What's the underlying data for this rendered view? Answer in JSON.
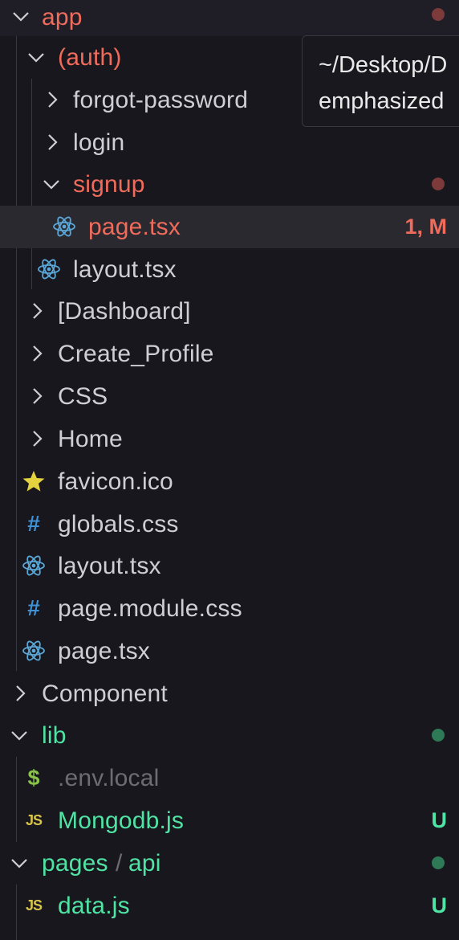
{
  "colors": {
    "background": "#18171d",
    "modified_red": "#ef6b5b",
    "untracked_green": "#4fe3a4",
    "default_text": "#cfcfd3",
    "ignored_text": "#6d6c73",
    "react_blue": "#5ba7d8",
    "css_blue": "#3f92d6",
    "js_yellow": "#d7c44b",
    "env_green": "#8bc34a",
    "favicon_yellow": "#e4d23f",
    "dot_red": "#7c3a3a",
    "dot_green": "#2f7a56"
  },
  "tooltip": {
    "line1": "~/Desktop/D",
    "line2": "emphasized"
  },
  "tree": {
    "app": {
      "label": "app",
      "icon": "chevron-down-icon"
    },
    "auth": {
      "label": "(auth)",
      "icon": "chevron-down-icon"
    },
    "forgot_password": {
      "label": "forgot-password",
      "icon": "chevron-right-icon"
    },
    "login": {
      "label": "login",
      "icon": "chevron-right-icon"
    },
    "signup": {
      "label": "signup",
      "icon": "chevron-down-icon"
    },
    "signup_page": {
      "label": "page.tsx",
      "badge": "1, M",
      "icon": "react-icon"
    },
    "auth_layout": {
      "label": "layout.tsx",
      "icon": "react-icon"
    },
    "dashboard": {
      "label": "[Dashboard]",
      "icon": "chevron-right-icon"
    },
    "create_profile": {
      "label": "Create_Profile",
      "icon": "chevron-right-icon"
    },
    "css": {
      "label": "CSS",
      "icon": "chevron-right-icon"
    },
    "home": {
      "label": "Home",
      "icon": "chevron-right-icon"
    },
    "favicon": {
      "label": "favicon.ico",
      "icon": "star-icon"
    },
    "globals": {
      "label": "globals.css",
      "icon": "hash-icon",
      "glyph": "#"
    },
    "app_layout": {
      "label": "layout.tsx",
      "icon": "react-icon"
    },
    "page_module": {
      "label": "page.module.css",
      "icon": "hash-icon",
      "glyph": "#"
    },
    "app_page": {
      "label": "page.tsx",
      "icon": "react-icon"
    },
    "component": {
      "label": "Component",
      "icon": "chevron-right-icon"
    },
    "lib": {
      "label": "lib",
      "icon": "chevron-down-icon"
    },
    "env_local": {
      "label": ".env.local",
      "icon": "dollar-icon",
      "glyph": "$"
    },
    "mongodb": {
      "label": "Mongodb.js",
      "badge": "U",
      "icon": "js-icon",
      "glyph": "JS"
    },
    "pages_api": {
      "label_a": "pages",
      "separator": "/",
      "label_b": "api",
      "icon": "chevron-down-icon"
    },
    "data_js": {
      "label": "data.js",
      "badge": "U",
      "icon": "js-icon",
      "glyph": "JS"
    }
  }
}
